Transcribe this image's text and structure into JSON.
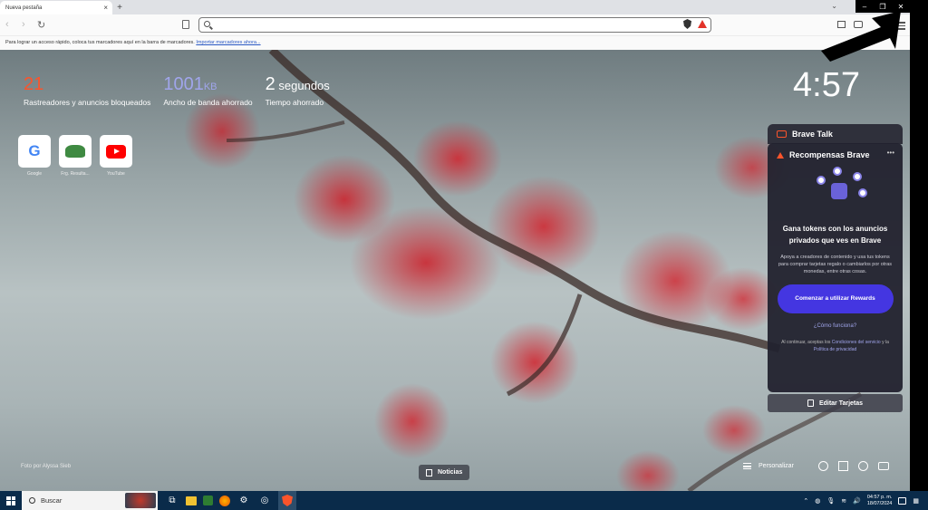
{
  "browser": {
    "tab_title": "Nueva pestaña",
    "tab_close": "×",
    "new_tab": "+",
    "tab_dropdown": "⌄",
    "window_controls": {
      "minimize": "–",
      "restore": "❐",
      "close": "✕"
    },
    "url_value": "",
    "bookmarks_hint": "Para lograr un acceso rápido, coloca tus marcadores aquí en la barra de marcadores.",
    "bookmarks_import": "Importar marcadores ahora..."
  },
  "stats": [
    {
      "value": "21",
      "unit": "",
      "label": "Rastreadores y anuncios bloqueados",
      "color": "#fb542b"
    },
    {
      "value": "1001",
      "unit": "KB",
      "label": "Ancho de banda ahorrado",
      "color": "#a0a5eb"
    },
    {
      "value": "2",
      "unit": " segundos",
      "label": "Tiempo ahorrado",
      "color": "#ffffff"
    }
  ],
  "clock": "4:57",
  "top_sites": [
    {
      "label": "Google",
      "icon": "google-icon"
    },
    {
      "label": "Frg. Resulta...",
      "icon": "frog-icon"
    },
    {
      "label": "YouTube",
      "icon": "youtube-icon"
    }
  ],
  "photo_credit": {
    "prefix": "Foto por",
    "author": "Alyssa Sieb"
  },
  "widgets": {
    "talk_title": "Brave Talk",
    "rewards_title": "Recompensas Brave",
    "rewards_more": "•••",
    "rewards_headline": "Gana tokens con los anuncios privados que ves en Brave",
    "rewards_desc": "Apoya a creadores de contenido y usa tus tokens para comprar tarjetas regalo o cambiarlos por otras monedas, entre otras cosas.",
    "rewards_button": "Comenzar a utilizar Rewards",
    "rewards_how": "¿Cómo funciona?",
    "legal_prefix": "Al continuar, aceptas los",
    "legal_terms": "Condiciones del servicio",
    "legal_and": "y la",
    "legal_privacy": "Política de privacidad",
    "edit_cards": "Editar Tarjetas"
  },
  "bottom_bar": {
    "news": "Noticias",
    "customize": "Personalizar"
  },
  "taskbar": {
    "search_placeholder": "Buscar",
    "time": "04:57 p. m.",
    "date": "18/07/2024"
  }
}
